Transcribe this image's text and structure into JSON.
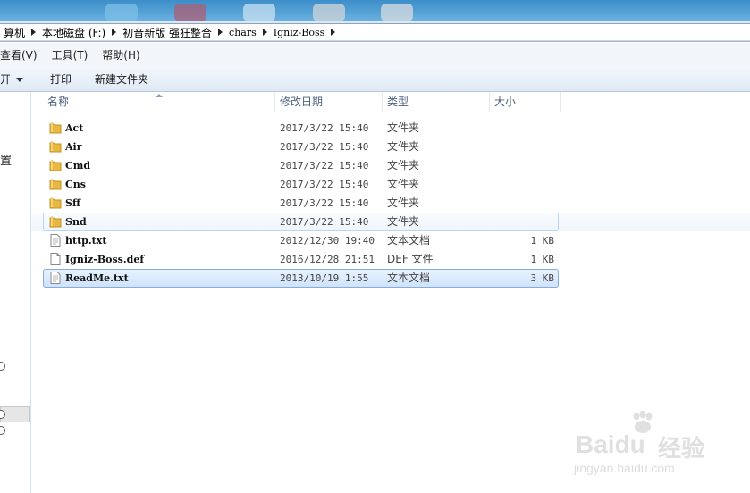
{
  "address": {
    "crumbs": [
      "算机",
      "本地磁盘 (F:)",
      "初音新版 强狂整合",
      "chars",
      "Igniz-Boss"
    ]
  },
  "menubar": {
    "items": [
      "查看(V)",
      "工具(T)",
      "帮助(H)"
    ]
  },
  "toolbar": {
    "organize_fragment": "开",
    "print_label": "打印",
    "new_folder_label": "新建文件夹"
  },
  "navpane": {
    "visible_text": "置"
  },
  "columns": {
    "name": "名称",
    "date": "修改日期",
    "type": "类型",
    "size": "大小"
  },
  "files": [
    {
      "name": "Act",
      "date": "2017/3/22 15:40",
      "type": "文件夹",
      "size": "",
      "kind": "folder"
    },
    {
      "name": "Air",
      "date": "2017/3/22 15:40",
      "type": "文件夹",
      "size": "",
      "kind": "folder"
    },
    {
      "name": "Cmd",
      "date": "2017/3/22 15:40",
      "type": "文件夹",
      "size": "",
      "kind": "folder"
    },
    {
      "name": "Cns",
      "date": "2017/3/22 15:40",
      "type": "文件夹",
      "size": "",
      "kind": "folder"
    },
    {
      "name": "Sff",
      "date": "2017/3/22 15:40",
      "type": "文件夹",
      "size": "",
      "kind": "folder"
    },
    {
      "name": "Snd",
      "date": "2017/3/22 15:40",
      "type": "文件夹",
      "size": "",
      "kind": "folder"
    },
    {
      "name": "http.txt",
      "date": "2012/12/30 19:40",
      "type": "文本文档",
      "size": "1 KB",
      "kind": "file"
    },
    {
      "name": "Igniz-Boss.def",
      "date": "2016/12/28 21:51",
      "type": "DEF 文件",
      "size": "1 KB",
      "kind": "file"
    },
    {
      "name": "ReadMe.txt",
      "date": "2013/10/19 1:55",
      "type": "文本文档",
      "size": "3 KB",
      "kind": "file"
    }
  ],
  "watermark": {
    "brand": "Baidu",
    "brand_cn": "经验",
    "url": "jingyan.baidu.com"
  },
  "colors": {
    "folder": "#e8b840",
    "selection_border": "#84acdd",
    "hover_border": "#b8d6fb"
  }
}
